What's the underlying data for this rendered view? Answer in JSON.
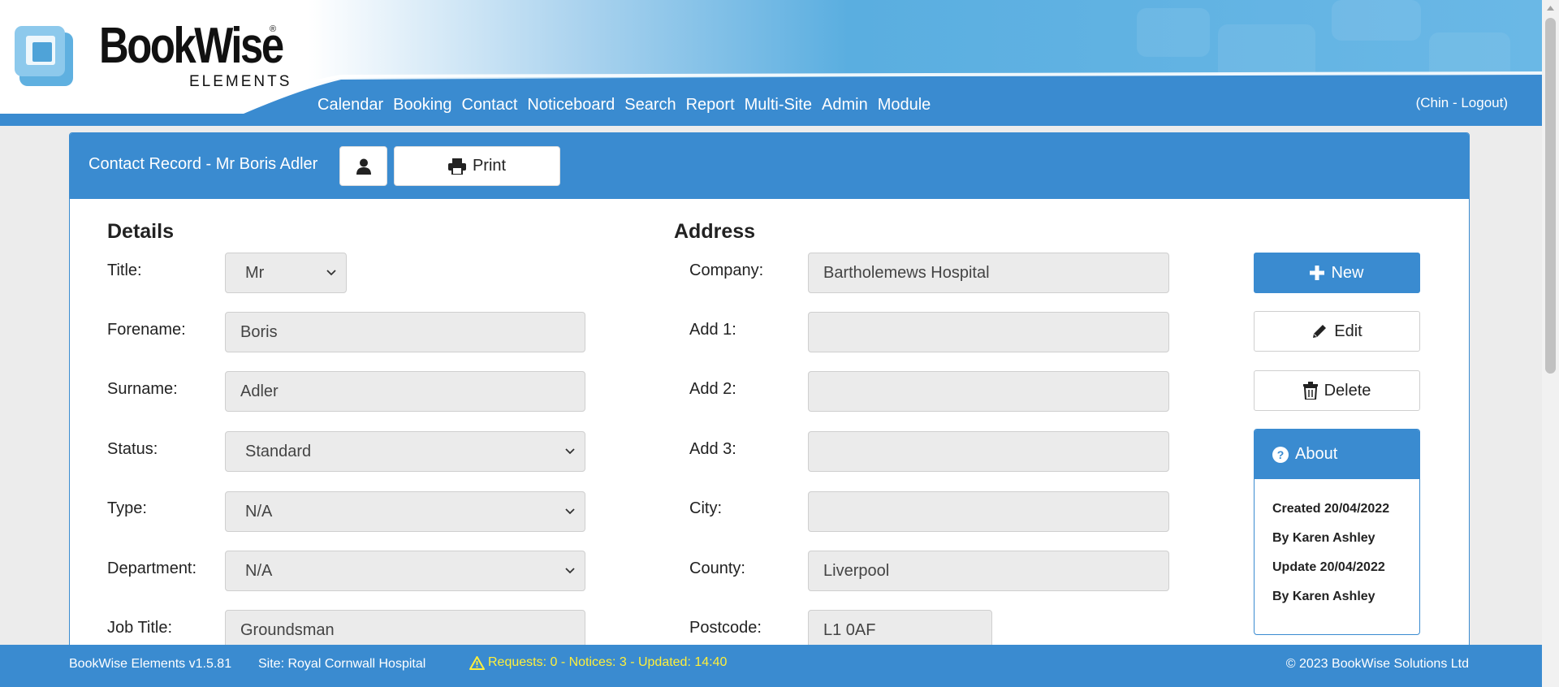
{
  "brand": {
    "name": "BookWise",
    "reg": "®",
    "subtitle": "ELEMENTS"
  },
  "nav": {
    "items": [
      "Calendar",
      "Booking",
      "Contact",
      "Noticeboard",
      "Search",
      "Report",
      "Multi-Site",
      "Admin",
      "Module"
    ],
    "user": "(Chin - Logout)"
  },
  "panel": {
    "title": "Contact Record - Mr Boris Adler",
    "print_label": "Print"
  },
  "details": {
    "heading": "Details",
    "fields": [
      {
        "label": "Title:",
        "value": "Mr"
      },
      {
        "label": "Forename:",
        "value": "Boris"
      },
      {
        "label": "Surname:",
        "value": "Adler"
      },
      {
        "label": "Status:",
        "value": "Standard"
      },
      {
        "label": "Type:",
        "value": "N/A"
      },
      {
        "label": "Department:",
        "value": "N/A"
      },
      {
        "label": "Job Title:",
        "value": "Groundsman"
      }
    ]
  },
  "address": {
    "heading": "Address",
    "fields": [
      {
        "label": "Company:",
        "value": "Bartholemews Hospital"
      },
      {
        "label": "Add 1:",
        "value": ""
      },
      {
        "label": "Add 2:",
        "value": ""
      },
      {
        "label": "Add 3:",
        "value": ""
      },
      {
        "label": "City:",
        "value": ""
      },
      {
        "label": "County:",
        "value": "Liverpool"
      },
      {
        "label": "Postcode:",
        "value": "L1 0AF"
      }
    ]
  },
  "actions": {
    "new_label": "New",
    "edit_label": "Edit",
    "delete_label": "Delete"
  },
  "about": {
    "title": "About",
    "lines": [
      "Created 20/04/2022",
      "By Karen Ashley",
      "Update 20/04/2022",
      "By Karen Ashley"
    ]
  },
  "footer": {
    "version": "BookWise Elements v1.5.81",
    "site": "Site: Royal Cornwall Hospital",
    "status": "Requests: 0 - Notices: 3 - Updated: 14:40",
    "copyright": "© 2023 BookWise Solutions Ltd"
  },
  "colors": {
    "primary": "#3a8bd0",
    "warning_text": "#ffef3a",
    "field_bg": "#ebebeb"
  }
}
